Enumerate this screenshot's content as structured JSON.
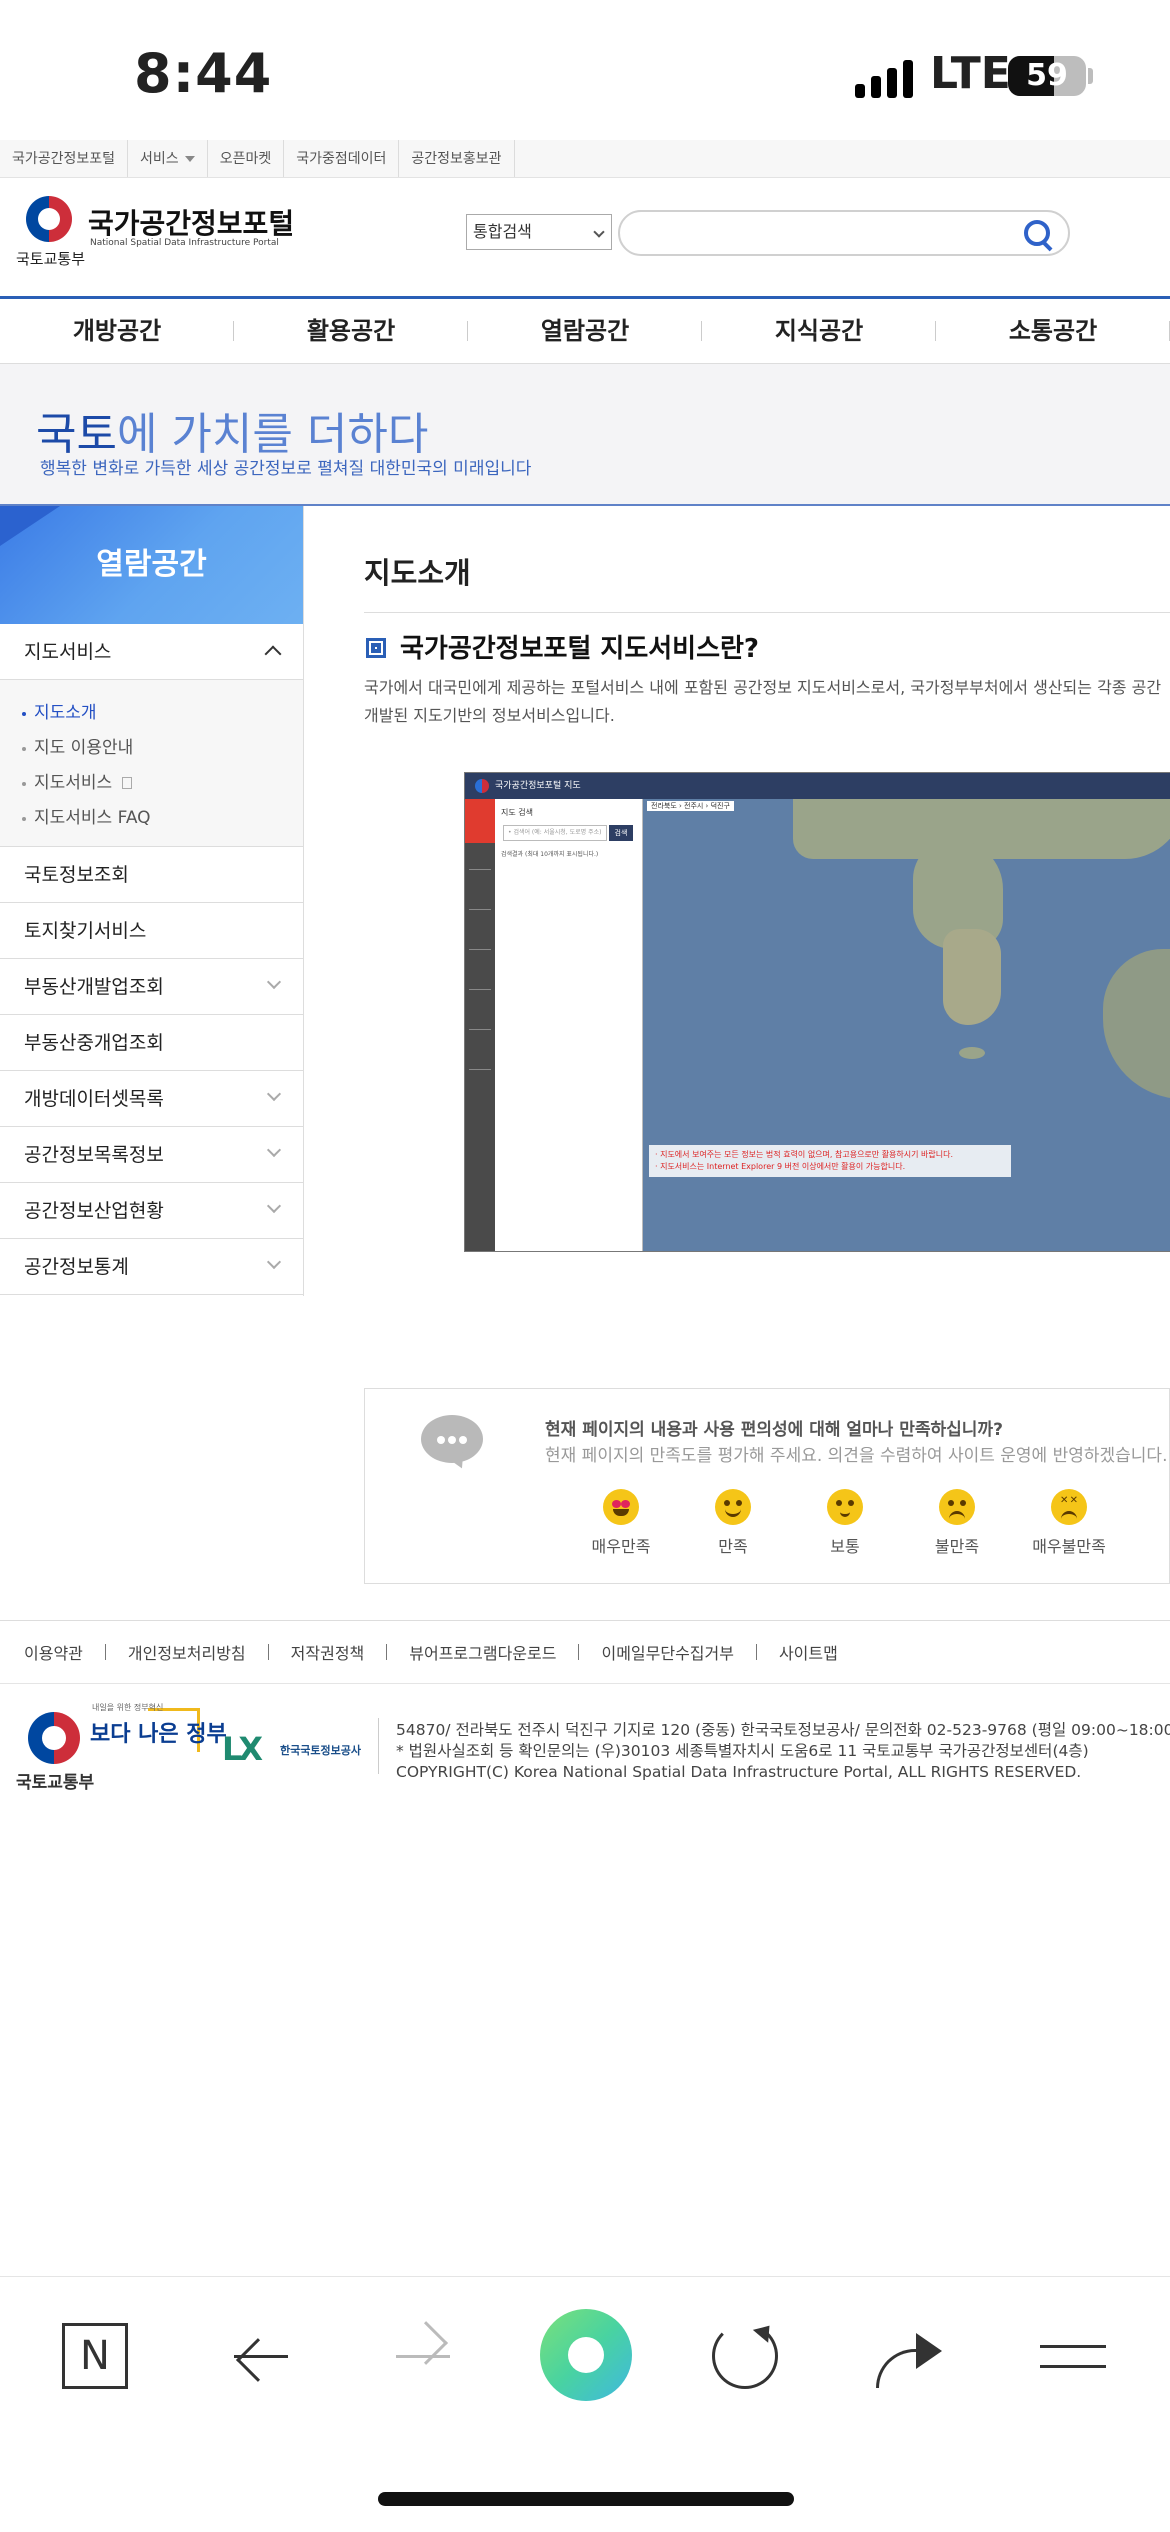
{
  "status_bar": {
    "time": "8:44",
    "network": "LTE",
    "battery": "59",
    "battery_level": 0.59
  },
  "util_nav": [
    "국가공간정보포털",
    "서비스",
    "오픈마켓",
    "국가중점데이터",
    "공간정보홍보관"
  ],
  "header": {
    "portal_name": "국가공간정보포털",
    "portal_name_en": "National Spatial Data Infrastructure Portal",
    "ministry": "국토교통부",
    "search_select": "통합검색",
    "search_placeholder": ""
  },
  "main_nav": [
    "개방공간",
    "활용공간",
    "열람공간",
    "지식공간",
    "소통공간"
  ],
  "banner": {
    "slogan_a": "국토",
    "slogan_b": "에 가치를 더하다",
    "subtitle": "행복한 변화로 가득한 세상 공간정보로 펼쳐질 대한민국의 미래입니다"
  },
  "sidebar": {
    "title": "열람공간",
    "open_section": "지도서비스",
    "submenu": [
      "지도소개",
      "지도 이용안내",
      "지도서비스",
      "지도서비스 FAQ"
    ],
    "items": [
      "국토정보조회",
      "토지찾기서비스",
      "부동산개발업조회",
      "부동산중개업조회",
      "개방데이터셋목록",
      "공간정보목록정보",
      "공간정보산업현황",
      "공간정보통계"
    ]
  },
  "content": {
    "page_title": "지도소개",
    "question": "국가공간정보포털 지도서비스란?",
    "desc_line1": "국가에서 대국민에게 제공하는 포털서비스 내에 포함된 공간정보 지도서비스로서, 국가정부부처에서 생산되는 각종 공간",
    "desc_line2": "개발된 지도기반의 정보서비스입니다."
  },
  "map_screenshot": {
    "header": "국가공간정보포털   지도",
    "panel_label": "지도 검색",
    "search_placeholder": "• 검색어 (예: 서울시청, 도로명 주소)",
    "search_button": "검색",
    "result": "검색결과 (최대 10개까지 표시됩니다.)",
    "crumb": "전라북도 › 전주시 › 덕진구",
    "notice_1": "· 지도에서 보여주는 모든 정보는 법적 효력이 없으며, 참고용으로만 활용하시기 바랍니다.",
    "notice_2": "· 지도서비스는 Internet Explorer 9 버전 이상에서만 활용이 가능합니다."
  },
  "survey": {
    "question": "현재 페이지의 내용과 사용 편의성에 대해 얼마나 만족하십니까?",
    "sub": "현재 페이지의 만족도를 평가해 주세요. 의견을 수렴하여 사이트 운영에 반영하겠습니다.",
    "options": [
      "매우만족",
      "만족",
      "보통",
      "불만족",
      "매우불만족"
    ]
  },
  "footer_links": [
    "이용약관",
    "개인정보처리방침",
    "저작권정책",
    "뷰어프로그램다운로드",
    "이메일무단수집거부",
    "사이트맵"
  ],
  "footer": {
    "ministry": "국토교통부",
    "gov_slogan_small": "내일을 위한 정부혁신",
    "gov_slogan": "보다 나은 정부",
    "lx": "LX",
    "lx_name": "한국국토정보공사",
    "address": "54870/ 전라북도 전주시 덕진구 기지로 120 (중동) 한국국토정보공사/ 문의전화 02-523-9768 (평일 09:00~18:00,",
    "note": "* 법원사실조회 등 확인문의는 (우)30103 세종특별자치시 도움6로 11 국토교통부 국가공간정보센터(4층)",
    "copyright": "COPYRIGHT(C) Korea National Spatial Data Infrastructure Portal, ALL RIGHTS RESERVED."
  },
  "browser_toolbar": {
    "n_label": "N"
  },
  "colors": {
    "accent": "#2a5fb6",
    "sidebar_head": "#3b7be6",
    "slogan": "#5a82d2"
  }
}
